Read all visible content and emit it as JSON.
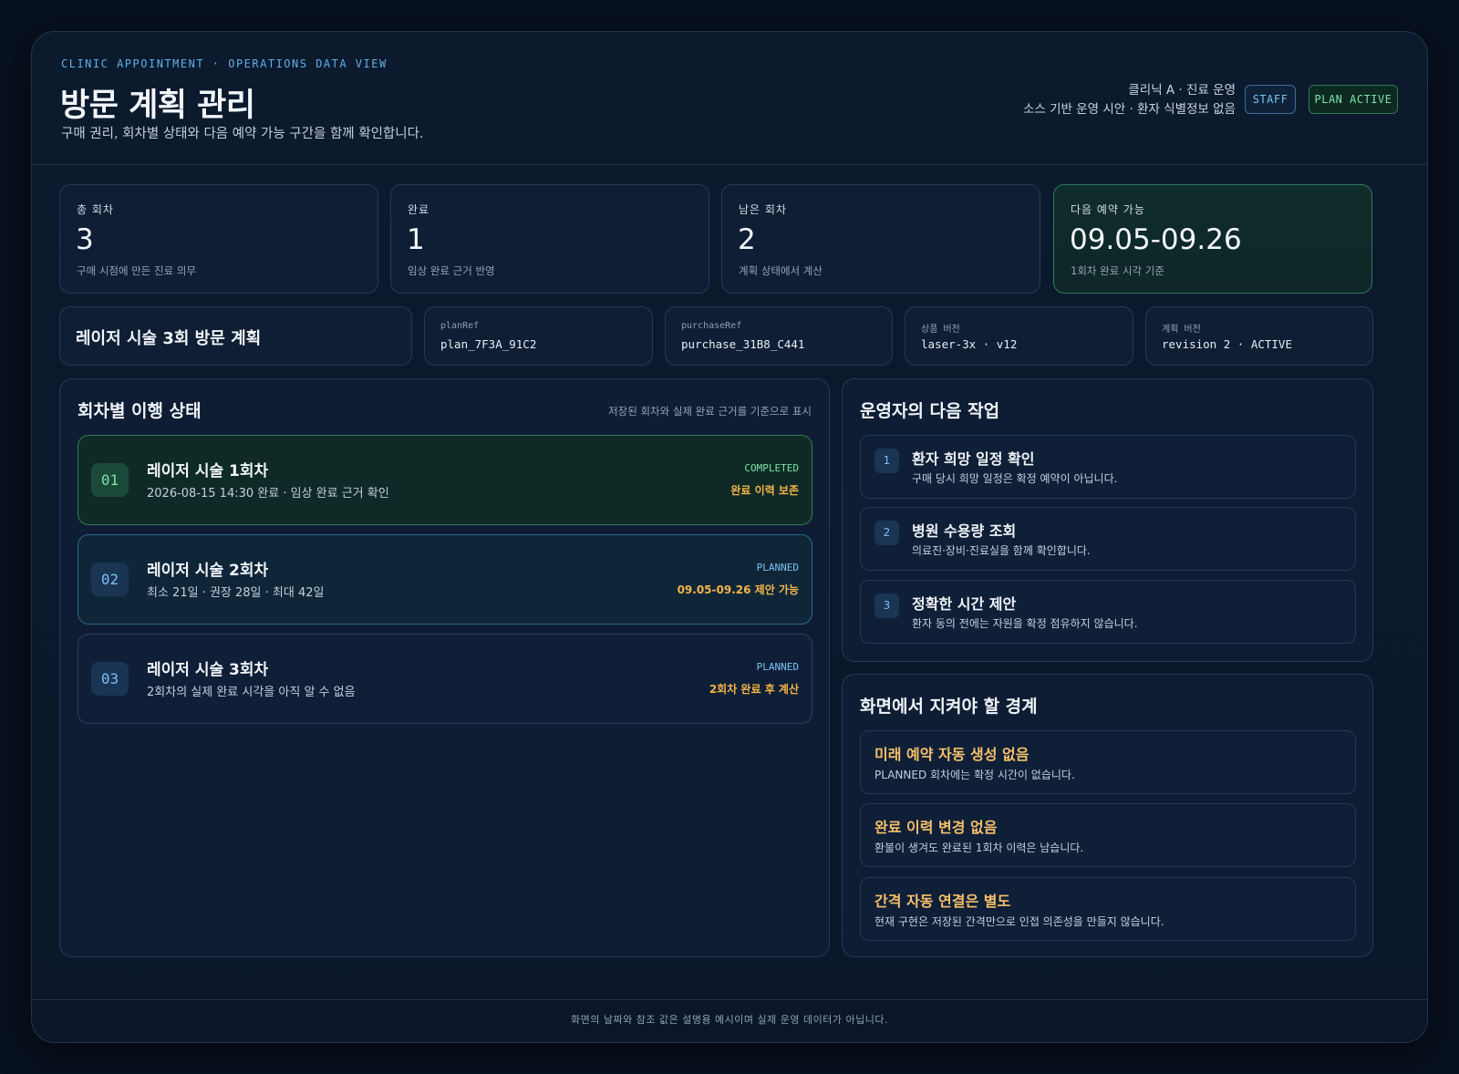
{
  "header": {
    "kicker": "CLINIC APPOINTMENT · OPERATIONS DATA VIEW",
    "title": "방문 계획 관리",
    "subtitle": "구매 권리, 회차별 상태와 다음 예약 가능 구간을 함께 확인합니다.",
    "meta_line1": "클리닉 A · 진료 운영",
    "meta_line2": "소스 기반 운영 시안 · 환자 식별정보 없음",
    "badge_staff": "STAFF",
    "badge_plan": "PLAN ACTIVE"
  },
  "stats": [
    {
      "label": "총 회차",
      "value": "3",
      "note": "구매 시점에 만든 진료 의무"
    },
    {
      "label": "완료",
      "value": "1",
      "note": "임상 완료 근거 반영"
    },
    {
      "label": "남은 회차",
      "value": "2",
      "note": "계획 상태에서 계산"
    },
    {
      "label": "다음 예약 가능",
      "value": "09.05-09.26",
      "note": "1회차 완료 시각 기준"
    }
  ],
  "plan_info": {
    "title": "레이저 시술 3회 방문 계획",
    "fields": [
      {
        "label": "planRef",
        "value": "plan_7F3A_91C2"
      },
      {
        "label": "purchaseRef",
        "value": "purchase_31B8_C441"
      },
      {
        "label": "상품 버전",
        "value": "laser-3x · v12"
      },
      {
        "label": "계획 버전",
        "value": "revision 2 · ACTIVE"
      }
    ]
  },
  "steps_panel": {
    "title": "회차별 이행 상태",
    "hint": "저장된 회차와 실제 완료 근거를 기준으로 표시",
    "steps": [
      {
        "num": "01",
        "title": "레이저 시술 1회차",
        "desc": "2026-08-15 14:30 완료 · 임상 완료 근거 확인",
        "status": "COMPLETED",
        "note": "완료 이력 보존"
      },
      {
        "num": "02",
        "title": "레이저 시술 2회차",
        "desc": "최소 21일 · 권장 28일 · 최대 42일",
        "status": "PLANNED",
        "note": "09.05-09.26 제안 가능"
      },
      {
        "num": "03",
        "title": "레이저 시술 3회차",
        "desc": "2회차의 실제 완료 시각을 아직 알 수 없음",
        "status": "PLANNED",
        "note": "2회차 완료 후 계산"
      }
    ]
  },
  "tasks_panel": {
    "title": "운영자의 다음 작업",
    "tasks": [
      {
        "num": "1",
        "title": "환자 희망 일정 확인",
        "desc": "구매 당시 희망 일정은 확정 예약이 아닙니다."
      },
      {
        "num": "2",
        "title": "병원 수용량 조회",
        "desc": "의료진·장비·진료실을 함께 확인합니다."
      },
      {
        "num": "3",
        "title": "정확한 시간 제안",
        "desc": "환자 동의 전에는 자원을 확정 점유하지 않습니다."
      }
    ]
  },
  "rules_panel": {
    "title": "화면에서 지켜야 할 경계",
    "rules": [
      {
        "title": "미래 예약 자동 생성 없음",
        "desc": "PLANNED 회차에는 확정 시간이 없습니다."
      },
      {
        "title": "완료 이력 변경 없음",
        "desc": "환불이 생겨도 완료된 1회차 이력은 남습니다."
      },
      {
        "title": "간격 자동 연결은 별도",
        "desc": "현재 구현은 저장된 간격만으로 인접 의존성을 만들지 않습니다."
      }
    ]
  },
  "footer": {
    "text": "화면의 날짜와 참조 값은 설명용 예시이며 실제 운영 데이터가 아닙니다."
  }
}
